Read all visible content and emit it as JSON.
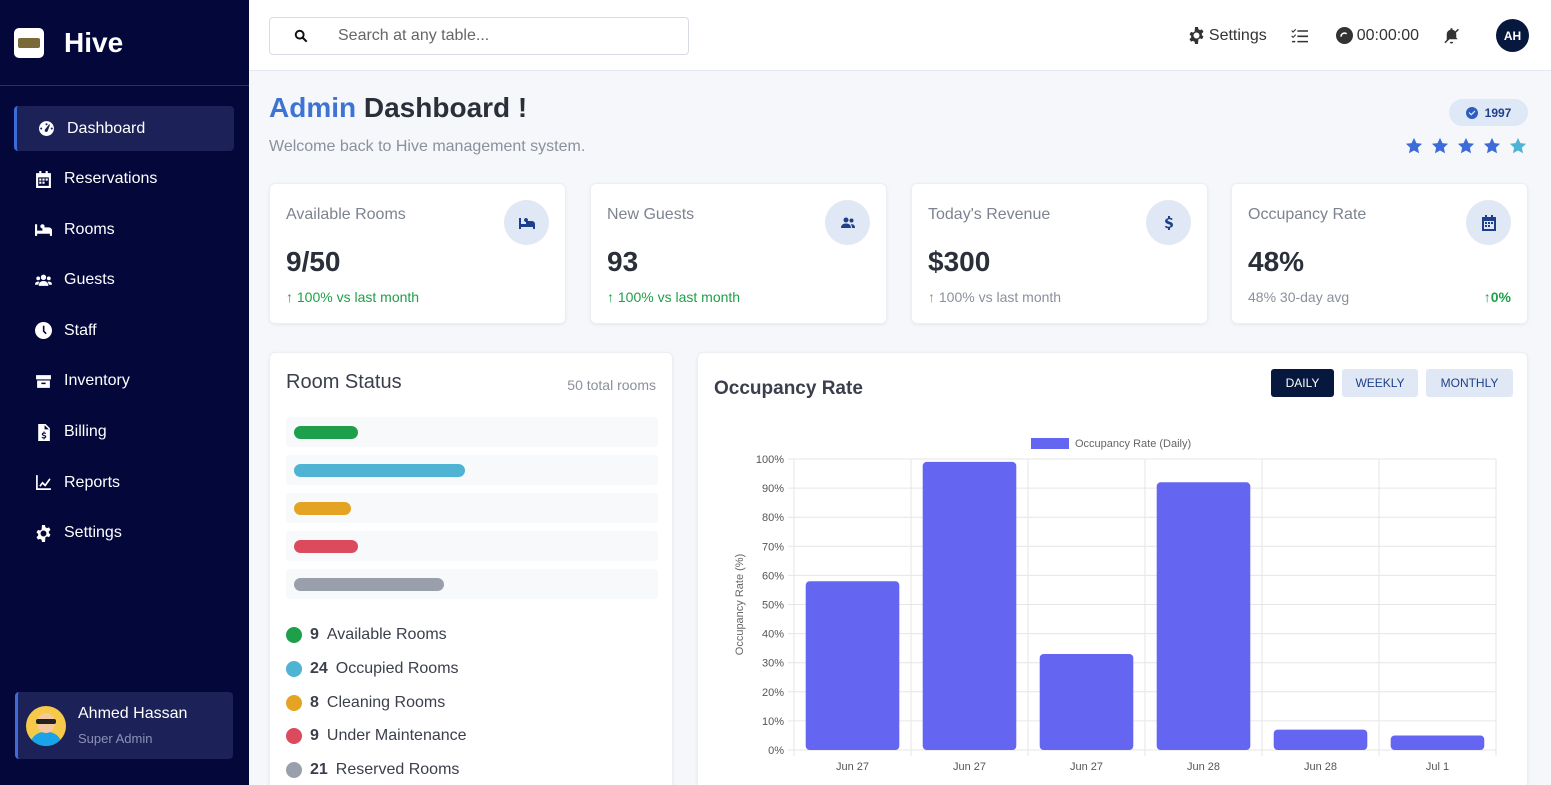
{
  "app": {
    "name": "Hive"
  },
  "sidebar": {
    "items": [
      {
        "label": "Dashboard",
        "icon": "dashboard-icon",
        "active": true
      },
      {
        "label": "Reservations",
        "icon": "calendar-icon"
      },
      {
        "label": "Rooms",
        "icon": "bed-icon"
      },
      {
        "label": "Guests",
        "icon": "users-icon"
      },
      {
        "label": "Staff",
        "icon": "clock-icon"
      },
      {
        "label": "Inventory",
        "icon": "box-icon"
      },
      {
        "label": "Billing",
        "icon": "invoice-icon"
      },
      {
        "label": "Reports",
        "icon": "chart-line-icon"
      },
      {
        "label": "Settings",
        "icon": "gear-icon"
      }
    ],
    "user": {
      "name": "Ahmed Hassan",
      "role": "Super Admin"
    }
  },
  "topbar": {
    "search_placeholder": "Search at any table...",
    "settings_label": "Settings",
    "timer": "00:00:00",
    "avatar_initials": "AH"
  },
  "header": {
    "title_accent": "Admin",
    "title_rest": "Dashboard !",
    "subtitle": "Welcome back to Hive management system.",
    "badge": "1997",
    "rating": 5
  },
  "cards": [
    {
      "label": "Available Rooms",
      "value": "9/50",
      "foot": "↑ 100% vs last month",
      "icon": "bed-icon"
    },
    {
      "label": "New Guests",
      "value": "93",
      "foot": "↑ 100% vs last month",
      "icon": "users-icon"
    },
    {
      "label": "Today's Revenue",
      "value": "$300",
      "foot": "↑ 100% vs last month",
      "icon": "dollar-icon"
    },
    {
      "label": "Occupancy Rate",
      "value": "48%",
      "foot": "48% 30-day avg",
      "foot_right": "0%",
      "icon": "calendar-icon"
    }
  ],
  "room_status": {
    "title": "Room Status",
    "total": "50 total rooms",
    "items": [
      {
        "count": "9",
        "label": "Available Rooms",
        "color": "#1ea04a"
      },
      {
        "count": "24",
        "label": "Occupied Rooms",
        "color": "#4fb3d4"
      },
      {
        "count": "8",
        "label": "Cleaning Rooms",
        "color": "#e5a323"
      },
      {
        "count": "9",
        "label": "Under Maintenance",
        "color": "#dc4a5e"
      },
      {
        "count": "21",
        "label": "Reserved Rooms",
        "color": "#9aa0ab"
      }
    ]
  },
  "occupancy": {
    "title": "Occupancy Rate",
    "periods": [
      "DAILY",
      "WEEKLY",
      "MONTHLY"
    ],
    "active_period": "DAILY"
  },
  "chart_data": {
    "type": "bar",
    "categories": [
      "Jun 27",
      "Jun 27",
      "Jun 27",
      "Jun 28",
      "Jun 28",
      "Jul 1"
    ],
    "series": [
      {
        "name": "Occupancy Rate (Daily)",
        "values": [
          58,
          99,
          33,
          92,
          7,
          5
        ],
        "color": "#6466f1"
      }
    ],
    "ylabel": "Occupancy Rate (%)",
    "ylim": [
      0,
      100
    ],
    "yticks": [
      "0%",
      "10%",
      "20%",
      "30%",
      "40%",
      "50%",
      "60%",
      "70%",
      "80%",
      "90%",
      "100%"
    ],
    "grid": true,
    "legend": "top-center"
  }
}
